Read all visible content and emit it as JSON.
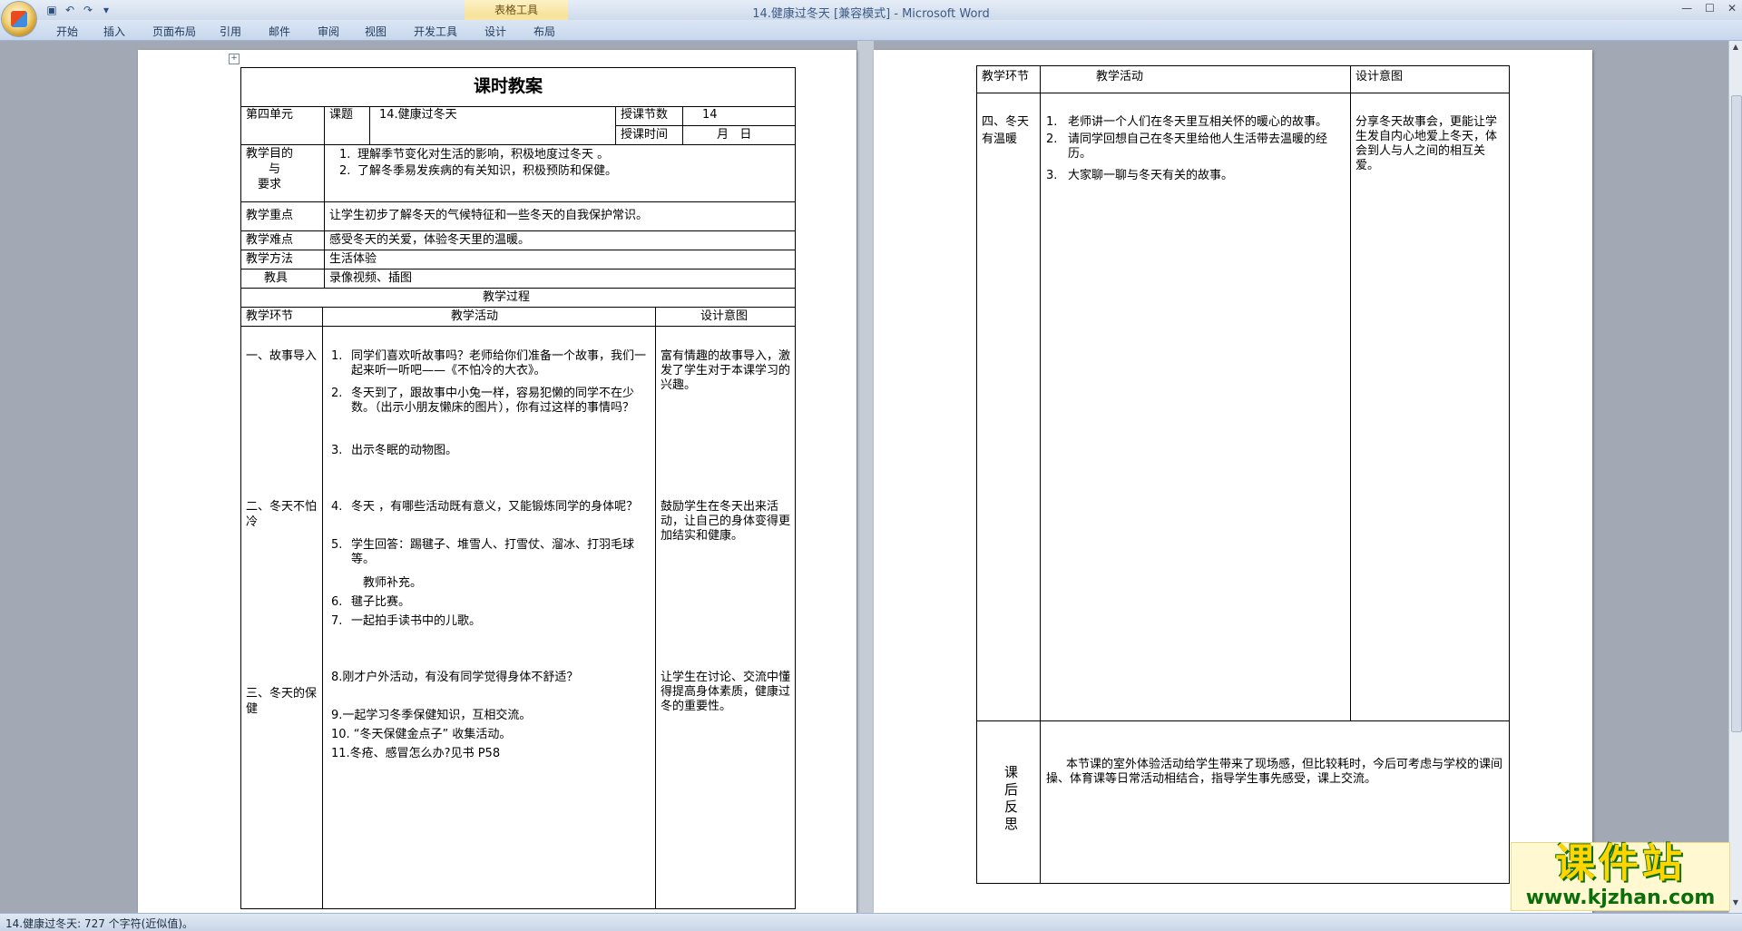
{
  "window": {
    "title": "14.健康过冬天 [兼容模式] - Microsoft Word",
    "context_tab_group": "表格工具"
  },
  "ribbon_tabs": [
    "开始",
    "插入",
    "页面布局",
    "引用",
    "邮件",
    "审阅",
    "视图",
    "开发工具",
    "设计",
    "布局"
  ],
  "status": {
    "doc_info": "14.健康过冬天: 727 个字符(近似值)。"
  },
  "watermark": {
    "line1": "课件站",
    "line2": "www.kjzhan.com"
  },
  "page1": {
    "title": "课时教案",
    "unit": "第四单元",
    "topic_label": "课题",
    "topic": "14.健康过冬天",
    "lessons_label": "授课节数",
    "lessons": "14",
    "time_label": "授课时间",
    "time_value": "月   日",
    "goal_label": [
      "教学目的",
      "与",
      "要求"
    ],
    "goals": [
      "理解季节变化对生活的影响，积极地度过冬天 。",
      "了解冬季易发疾病的有关知识，积极预防和保健。"
    ],
    "key_label": "教学重点",
    "key": "让学生初步了解冬天的气候特征和一些冬天的自我保护常识。",
    "diff_label": "教学难点",
    "diff": "感受冬天的关爱，体验冬天里的温暖。",
    "method_label": "教学方法",
    "method": "生活体验",
    "tools_label": "教具",
    "tools": "录像视频、插图",
    "process_label": "教学过程",
    "col_stage": "教学环节",
    "col_activity": "教学活动",
    "col_intent": "设计意图",
    "stage1": "一、故事导入",
    "stage2": [
      "二、冬天不怕",
      "冷"
    ],
    "stage3": [
      "三、冬天的保",
      "健"
    ],
    "act1": "同学们喜欢听故事吗？老师给你们准备一个故事，我们一起来听一听吧——《不怕冷的大衣》。",
    "act2": "冬天到了，跟故事中小兔一样，容易犯懒的同学不在少数。（出示小朋友懒床的图片），你有过这样的事情吗？",
    "act3": "出示冬眠的动物图。",
    "act4": "冬天 ，有哪些活动既有意义，又能锻炼同学的身体呢？",
    "act5": "学生回答：踢毽子、堆雪人、打雪仗、溜冰、打羽毛球等。",
    "act5b": "教师补充。",
    "act6": "毽子比赛。",
    "act7": "一起拍手读书中的儿歌。",
    "act8": "8.刚才户外活动，有没有同学觉得身体不舒适？",
    "act9": "9.一起学习冬季保健知识，互相交流。",
    "act10": "10. “冬天保健金点子” 收集活动。",
    "act11": "11.冬疮、感冒怎么办?见书 P58",
    "intent1": "富有情趣的故事导入，激发了学生对于本课学习的兴趣。",
    "intent2": "鼓励学生在冬天出来活动，让自己的身体变得更加结实和健康。",
    "intent3": "让学生在讨论、交流中懂得提高身体素质，健康过冬的重要性。"
  },
  "page2": {
    "col_stage": "教学环节",
    "col_activity": "教学活动",
    "col_intent": "设计意图",
    "stage4": [
      "四、冬天",
      "有温暖"
    ],
    "acts": [
      "老师讲一个人们在冬天里互相关怀的暖心的故事。",
      "请同学回想自己在冬天里给他人生活带去温暖的经历。",
      "大家聊一聊与冬天有关的故事。"
    ],
    "intent4": "分享冬天故事会，更能让学生发自内心地爱上冬天，体会到人与人之间的相互关爱。",
    "reflect_label": [
      "课",
      "后",
      "反",
      "思"
    ],
    "reflect": "本节课的室外体验活动给学生带来了现场感，但比较耗时，今后可考虑与学校的课间操、体育课等日常活动相结合，指导学生事先感受，课上交流。"
  }
}
